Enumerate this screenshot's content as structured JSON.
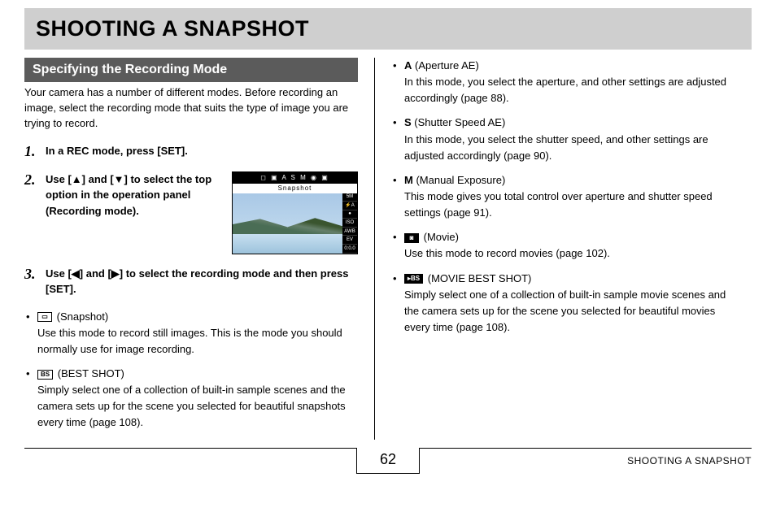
{
  "header": {
    "title": "SHOOTING A SNAPSHOT"
  },
  "section": {
    "heading": "Specifying the Recording Mode"
  },
  "intro": "Your camera has a number of different modes. Before recording an image, select the recording mode that suits the type of image you are trying to record.",
  "steps": [
    {
      "num": "1.",
      "text": "In a REC mode, press [SET]."
    },
    {
      "num": "2.",
      "text": "Use [▲] and [▼] to select the top option in the operation panel (Recording mode)."
    },
    {
      "num": "3.",
      "text": "Use [◀] and [▶] to select the recording mode and then press [SET]."
    }
  ],
  "camera_screen": {
    "top_icons": "◻ ▣ A S M ◉ ▣",
    "label": "Snapshot",
    "side": [
      "5M",
      "⚡A",
      "●",
      "ISO",
      "AWB",
      "EV",
      "0:0.0"
    ]
  },
  "modes_left": [
    {
      "icon": "▭",
      "icon_filled": false,
      "name": "(Snapshot)",
      "desc": "Use this mode to record still images. This is the mode you should normally use for image recording."
    },
    {
      "icon": "BS",
      "icon_filled": false,
      "name": "(BEST SHOT)",
      "desc": "Simply select one of a collection of built-in sample scenes and the camera sets up for the scene you selected for beautiful snapshots every time (page 108)."
    }
  ],
  "modes_right": [
    {
      "letter": "A",
      "name": "(Aperture AE)",
      "desc": "In this mode, you select the aperture, and other settings are adjusted accordingly (page 88)."
    },
    {
      "letter": "S",
      "name": "(Shutter Speed AE)",
      "desc": "In this mode, you select the shutter speed, and other settings are adjusted accordingly (page 90)."
    },
    {
      "letter": "M",
      "name": "(Manual Exposure)",
      "desc": "This mode gives you total control over aperture and shutter speed settings (page 91)."
    },
    {
      "icon": "◙",
      "icon_filled": true,
      "name": "(Movie)",
      "desc": "Use this mode to record movies (page 102)."
    },
    {
      "icon": "▸BS",
      "icon_filled": true,
      "name": "(MOVIE BEST SHOT)",
      "desc": "Simply select one of a collection of built-in sample movie scenes and the camera sets up for the scene you selected for beautiful movies every time (page 108)."
    }
  ],
  "footer": {
    "page_number": "62",
    "label": "SHOOTING A SNAPSHOT"
  }
}
